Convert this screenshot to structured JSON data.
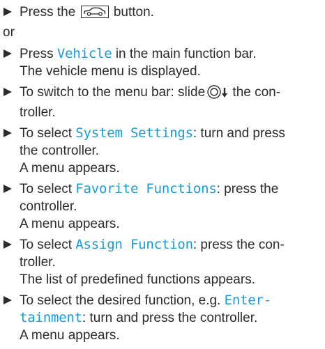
{
  "steps": {
    "s1": {
      "before": "Press the",
      "icon": "car-icon",
      "after": "button."
    },
    "or": "or",
    "s2": {
      "kw": "Vehicle",
      "rest": " in the main function bar.",
      "result": "The vehicle menu is displayed."
    },
    "s3": {
      "before": "To switch to the menu bar: slide",
      "icon": "controller-slide-down-icon",
      "after": " the con-",
      "line2": "troller."
    },
    "s4": {
      "before": "To select ",
      "kw": "System Settings",
      "after": ": turn and press",
      "line2": "the controller.",
      "result": "A menu appears."
    },
    "s5": {
      "before": "To select ",
      "kw": "Favorite Functions",
      "after": ": press the",
      "line2": "controller.",
      "result": "A menu appears."
    },
    "s6": {
      "before": "To select ",
      "kw": "Assign Function",
      "after": ": press the con-",
      "line2": "troller.",
      "result": "The list of predefined functions appears."
    },
    "s7": {
      "before": "To select the desired function, e.g. ",
      "kw1": "Enter-",
      "kw2": "tainment",
      "after": ": turn and press the controller.",
      "result": "A menu appears."
    }
  },
  "s2_prefix": "Press ",
  "colors": {
    "text": "#2b2b2b",
    "keyword": "#1a9bd7"
  }
}
